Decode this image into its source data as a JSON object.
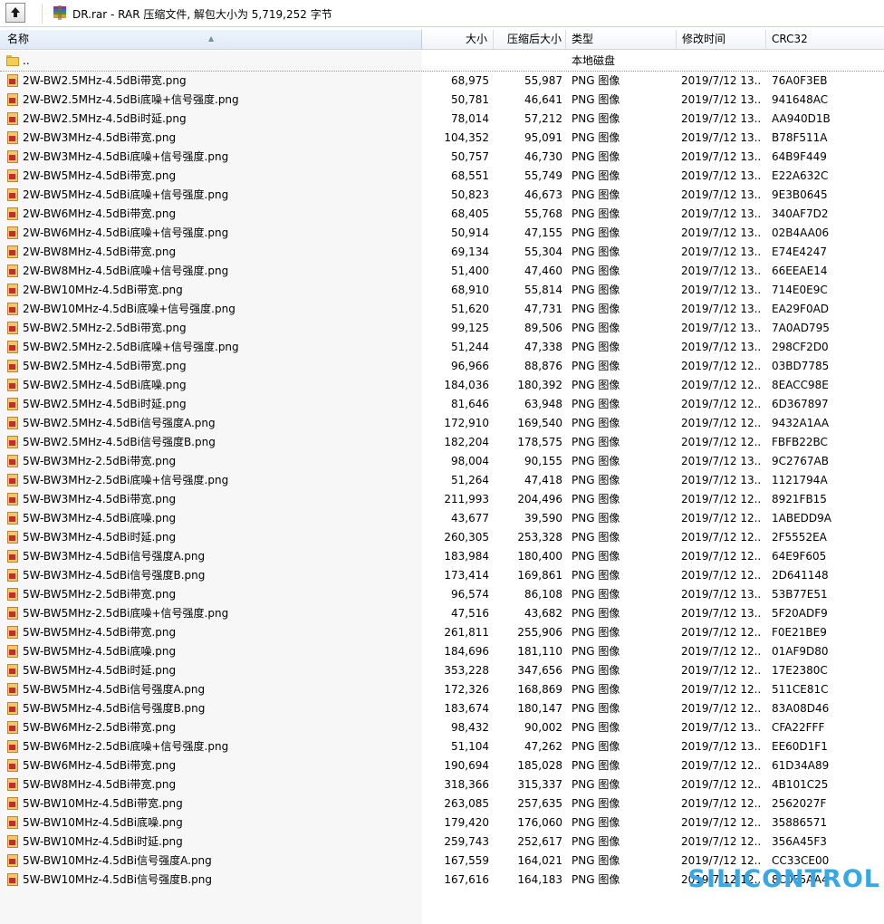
{
  "toolbar": {
    "up_button_icon": "up-arrow-icon",
    "archive_icon": "rar-archive-icon",
    "path_text": "DR.rar - RAR 压缩文件, 解包大小为 5,719,252 字节"
  },
  "columns": {
    "name": "名称",
    "size": "大小",
    "packed": "压缩后大小",
    "type": "类型",
    "modified": "修改时间",
    "crc": "CRC32"
  },
  "parent": {
    "name": "..",
    "type": "本地磁盘"
  },
  "files": [
    {
      "name": "2W-BW2.5MHz-4.5dBi带宽.png",
      "size": "68,975",
      "packed": "55,987",
      "type": "PNG 图像",
      "modified": "2019/7/12 13...",
      "crc": "76A0F3EB"
    },
    {
      "name": "2W-BW2.5MHz-4.5dBi底噪+信号强度.png",
      "size": "50,781",
      "packed": "46,641",
      "type": "PNG 图像",
      "modified": "2019/7/12 13...",
      "crc": "941648AC"
    },
    {
      "name": "2W-BW2.5MHz-4.5dBi时延.png",
      "size": "78,014",
      "packed": "57,212",
      "type": "PNG 图像",
      "modified": "2019/7/12 13...",
      "crc": "AA940D1B"
    },
    {
      "name": "2W-BW3MHz-4.5dBi带宽.png",
      "size": "104,352",
      "packed": "95,091",
      "type": "PNG 图像",
      "modified": "2019/7/12 13...",
      "crc": "B78F511A"
    },
    {
      "name": "2W-BW3MHz-4.5dBi底噪+信号强度.png",
      "size": "50,757",
      "packed": "46,730",
      "type": "PNG 图像",
      "modified": "2019/7/12 13...",
      "crc": "64B9F449"
    },
    {
      "name": "2W-BW5MHz-4.5dBi带宽.png",
      "size": "68,551",
      "packed": "55,749",
      "type": "PNG 图像",
      "modified": "2019/7/12 13...",
      "crc": "E22A632C"
    },
    {
      "name": "2W-BW5MHz-4.5dBi底噪+信号强度.png",
      "size": "50,823",
      "packed": "46,673",
      "type": "PNG 图像",
      "modified": "2019/7/12 13...",
      "crc": "9E3B0645"
    },
    {
      "name": "2W-BW6MHz-4.5dBi带宽.png",
      "size": "68,405",
      "packed": "55,768",
      "type": "PNG 图像",
      "modified": "2019/7/12 13...",
      "crc": "340AF7D2"
    },
    {
      "name": "2W-BW6MHz-4.5dBi底噪+信号强度.png",
      "size": "50,914",
      "packed": "47,155",
      "type": "PNG 图像",
      "modified": "2019/7/12 13...",
      "crc": "02B4AA06"
    },
    {
      "name": "2W-BW8MHz-4.5dBi带宽.png",
      "size": "69,134",
      "packed": "55,304",
      "type": "PNG 图像",
      "modified": "2019/7/12 13...",
      "crc": "E74E4247"
    },
    {
      "name": "2W-BW8MHz-4.5dBi底噪+信号强度.png",
      "size": "51,400",
      "packed": "47,460",
      "type": "PNG 图像",
      "modified": "2019/7/12 13...",
      "crc": "66EEAE14"
    },
    {
      "name": "2W-BW10MHz-4.5dBi带宽.png",
      "size": "68,910",
      "packed": "55,814",
      "type": "PNG 图像",
      "modified": "2019/7/12 13...",
      "crc": "714E0E9C"
    },
    {
      "name": "2W-BW10MHz-4.5dBi底噪+信号强度.png",
      "size": "51,620",
      "packed": "47,731",
      "type": "PNG 图像",
      "modified": "2019/7/12 13...",
      "crc": "EA29F0AD"
    },
    {
      "name": "5W-BW2.5MHz-2.5dBi带宽.png",
      "size": "99,125",
      "packed": "89,506",
      "type": "PNG 图像",
      "modified": "2019/7/12 13...",
      "crc": "7A0AD795"
    },
    {
      "name": "5W-BW2.5MHz-2.5dBi底噪+信号强度.png",
      "size": "51,244",
      "packed": "47,338",
      "type": "PNG 图像",
      "modified": "2019/7/12 13...",
      "crc": "298CF2D0"
    },
    {
      "name": "5W-BW2.5MHz-4.5dBi带宽.png",
      "size": "96,966",
      "packed": "88,876",
      "type": "PNG 图像",
      "modified": "2019/7/12 12...",
      "crc": "03BD7785"
    },
    {
      "name": "5W-BW2.5MHz-4.5dBi底噪.png",
      "size": "184,036",
      "packed": "180,392",
      "type": "PNG 图像",
      "modified": "2019/7/12 12...",
      "crc": "8EACC98E"
    },
    {
      "name": "5W-BW2.5MHz-4.5dBi时延.png",
      "size": "81,646",
      "packed": "63,948",
      "type": "PNG 图像",
      "modified": "2019/7/12 12...",
      "crc": "6D367897"
    },
    {
      "name": "5W-BW2.5MHz-4.5dBi信号强度A.png",
      "size": "172,910",
      "packed": "169,540",
      "type": "PNG 图像",
      "modified": "2019/7/12 12...",
      "crc": "9432A1AA"
    },
    {
      "name": "5W-BW2.5MHz-4.5dBi信号强度B.png",
      "size": "182,204",
      "packed": "178,575",
      "type": "PNG 图像",
      "modified": "2019/7/12 12...",
      "crc": "FBFB22BC"
    },
    {
      "name": "5W-BW3MHz-2.5dBi带宽.png",
      "size": "98,004",
      "packed": "90,155",
      "type": "PNG 图像",
      "modified": "2019/7/12 13...",
      "crc": "9C2767AB"
    },
    {
      "name": "5W-BW3MHz-2.5dBi底噪+信号强度.png",
      "size": "51,264",
      "packed": "47,418",
      "type": "PNG 图像",
      "modified": "2019/7/12 13...",
      "crc": "1121794A"
    },
    {
      "name": "5W-BW3MHz-4.5dBi带宽.png",
      "size": "211,993",
      "packed": "204,496",
      "type": "PNG 图像",
      "modified": "2019/7/12 12...",
      "crc": "8921FB15"
    },
    {
      "name": "5W-BW3MHz-4.5dBi底噪.png",
      "size": "43,677",
      "packed": "39,590",
      "type": "PNG 图像",
      "modified": "2019/7/12 12...",
      "crc": "1ABEDD9A"
    },
    {
      "name": "5W-BW3MHz-4.5dBi时延.png",
      "size": "260,305",
      "packed": "253,328",
      "type": "PNG 图像",
      "modified": "2019/7/12 12...",
      "crc": "2F5552EA"
    },
    {
      "name": "5W-BW3MHz-4.5dBi信号强度A.png",
      "size": "183,984",
      "packed": "180,400",
      "type": "PNG 图像",
      "modified": "2019/7/12 12...",
      "crc": "64E9F605"
    },
    {
      "name": "5W-BW3MHz-4.5dBi信号强度B.png",
      "size": "173,414",
      "packed": "169,861",
      "type": "PNG 图像",
      "modified": "2019/7/12 12...",
      "crc": "2D641148"
    },
    {
      "name": "5W-BW5MHz-2.5dBi带宽.png",
      "size": "96,574",
      "packed": "86,108",
      "type": "PNG 图像",
      "modified": "2019/7/12 13...",
      "crc": "53B77E51"
    },
    {
      "name": "5W-BW5MHz-2.5dBi底噪+信号强度.png",
      "size": "47,516",
      "packed": "43,682",
      "type": "PNG 图像",
      "modified": "2019/7/12 13...",
      "crc": "5F20ADF9"
    },
    {
      "name": "5W-BW5MHz-4.5dBi带宽.png",
      "size": "261,811",
      "packed": "255,906",
      "type": "PNG 图像",
      "modified": "2019/7/12 12...",
      "crc": "F0E21BE9"
    },
    {
      "name": "5W-BW5MHz-4.5dBi底噪.png",
      "size": "184,696",
      "packed": "181,110",
      "type": "PNG 图像",
      "modified": "2019/7/12 12...",
      "crc": "01AF9D80"
    },
    {
      "name": "5W-BW5MHz-4.5dBi时延.png",
      "size": "353,228",
      "packed": "347,656",
      "type": "PNG 图像",
      "modified": "2019/7/12 12...",
      "crc": "17E2380C"
    },
    {
      "name": "5W-BW5MHz-4.5dBi信号强度A.png",
      "size": "172,326",
      "packed": "168,869",
      "type": "PNG 图像",
      "modified": "2019/7/12 12...",
      "crc": "511CE81C"
    },
    {
      "name": "5W-BW5MHz-4.5dBi信号强度B.png",
      "size": "183,674",
      "packed": "180,147",
      "type": "PNG 图像",
      "modified": "2019/7/12 12...",
      "crc": "83A08D46"
    },
    {
      "name": "5W-BW6MHz-2.5dBi带宽.png",
      "size": "98,432",
      "packed": "90,002",
      "type": "PNG 图像",
      "modified": "2019/7/12 13...",
      "crc": "CFA22FFF"
    },
    {
      "name": "5W-BW6MHz-2.5dBi底噪+信号强度.png",
      "size": "51,104",
      "packed": "47,262",
      "type": "PNG 图像",
      "modified": "2019/7/12 13...",
      "crc": "EE60D1F1"
    },
    {
      "name": "5W-BW6MHz-4.5dBi带宽.png",
      "size": "190,694",
      "packed": "185,028",
      "type": "PNG 图像",
      "modified": "2019/7/12 12...",
      "crc": "61D34A89"
    },
    {
      "name": "5W-BW8MHz-4.5dBi带宽.png",
      "size": "318,366",
      "packed": "315,337",
      "type": "PNG 图像",
      "modified": "2019/7/12 12...",
      "crc": "4B101C25"
    },
    {
      "name": "5W-BW10MHz-4.5dBi带宽.png",
      "size": "263,085",
      "packed": "257,635",
      "type": "PNG 图像",
      "modified": "2019/7/12 12...",
      "crc": "2562027F"
    },
    {
      "name": "5W-BW10MHz-4.5dBi底噪.png",
      "size": "179,420",
      "packed": "176,060",
      "type": "PNG 图像",
      "modified": "2019/7/12 12...",
      "crc": "35886571"
    },
    {
      "name": "5W-BW10MHz-4.5dBi时延.png",
      "size": "259,743",
      "packed": "252,617",
      "type": "PNG 图像",
      "modified": "2019/7/12 12...",
      "crc": "356A45F3"
    },
    {
      "name": "5W-BW10MHz-4.5dBi信号强度A.png",
      "size": "167,559",
      "packed": "164,021",
      "type": "PNG 图像",
      "modified": "2019/7/12 12...",
      "crc": "CC33CE00"
    },
    {
      "name": "5W-BW10MHz-4.5dBi信号强度B.png",
      "size": "167,616",
      "packed": "164,183",
      "type": "PNG 图像",
      "modified": "2019/7/12 12...",
      "crc": "8C0F5AA4"
    }
  ],
  "file_icon": "png-image-icon",
  "folder_icon": "folder-icon",
  "watermark": "SILICONTROL",
  "colors": {
    "watermark": "#39a7e3",
    "header_selected": "#dfeaf6"
  }
}
